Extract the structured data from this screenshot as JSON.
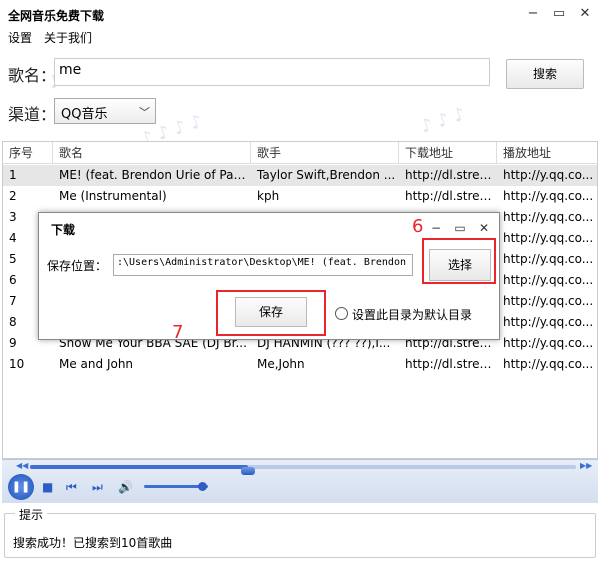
{
  "window": {
    "title": "全网音乐免费下载",
    "minimize_glyph": "−",
    "maximize_glyph": "▭",
    "close_glyph": "✕"
  },
  "menu": {
    "items": [
      "设置",
      "关于我们"
    ]
  },
  "search": {
    "label": "歌名：",
    "value": "me",
    "button_label": "搜索"
  },
  "channel": {
    "label": "渠道：",
    "selected": "QQ音乐"
  },
  "table": {
    "columns": [
      "序号",
      "歌名",
      "歌手",
      "下载地址",
      "播放地址"
    ],
    "rows": [
      [
        "1",
        "ME! (feat. Brendon Urie of Pan...",
        "Taylor Swift,Brendon ...",
        "http://dl.strea...",
        "http://y.qq.co..."
      ],
      [
        "2",
        "Me (Instrumental)",
        "kph",
        "http://dl.strea...",
        "http://y.qq.co..."
      ],
      [
        "3",
        "",
        "",
        "",
        "http://y.qq.co..."
      ],
      [
        "4",
        "",
        "",
        "",
        "http://y.qq.co..."
      ],
      [
        "5",
        "",
        "",
        "",
        "http://y.qq.co..."
      ],
      [
        "6",
        "",
        "",
        "",
        "http://y.qq.co..."
      ],
      [
        "7",
        "",
        "",
        "",
        "http://y.qq.co..."
      ],
      [
        "8",
        "",
        "",
        "",
        "http://y.qq.co..."
      ],
      [
        "9",
        "Show Me Your BBA SAE (DJ Br...",
        "DJ HANMIN (??? ??),I...",
        "http://dl.strea...",
        "http://y.qq.co..."
      ],
      [
        "10",
        "Me and John",
        "Me,John",
        "http://dl.strea...",
        "http://y.qq.co..."
      ]
    ],
    "selected_row": 0
  },
  "dialog": {
    "title": "下载",
    "save_location_label": "保存位置：",
    "path_value": ":\\Users\\Administrator\\Desktop\\ME! (feat. Brendon U",
    "choose_button": "选择",
    "save_button": "保存",
    "default_dir_label": "设置此目录为默认目录"
  },
  "callouts": {
    "choose_number": "6",
    "save_number": "7",
    "color": "#e8262b"
  },
  "player": {
    "progress_fraction": 0.4,
    "volume_fraction": 0.9
  },
  "status": {
    "legend": "提示",
    "message": "搜索成功！已搜索到10首歌曲"
  },
  "colors": {
    "accent": "#3c6fd0",
    "highlight": "#e8262b"
  }
}
